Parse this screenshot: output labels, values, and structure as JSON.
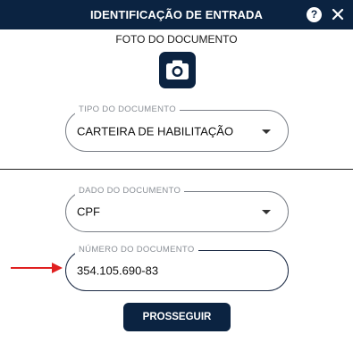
{
  "header": {
    "title": "IDENTIFICAÇÃO DE ENTRADA",
    "help_label": "?",
    "icons": {
      "help": "help-icon",
      "close": "close-icon"
    }
  },
  "photo": {
    "label": "FOTO DO DOCUMENTO",
    "icon": "camera-icon"
  },
  "document_type": {
    "label": "TIPO DO DOCUMENTO",
    "value": "CARTEIRA DE HABILITAÇÃO"
  },
  "document_data": {
    "label": "DADO DO DOCUMENTO",
    "value": "CPF"
  },
  "document_number": {
    "label": "NÚMERO DO DOCUMENTO",
    "value": "354.105.690-83"
  },
  "actions": {
    "proceed_label": "PROSSEGUIR"
  },
  "colors": {
    "primary": "#0b2341",
    "annotation_arrow": "#e02020"
  }
}
